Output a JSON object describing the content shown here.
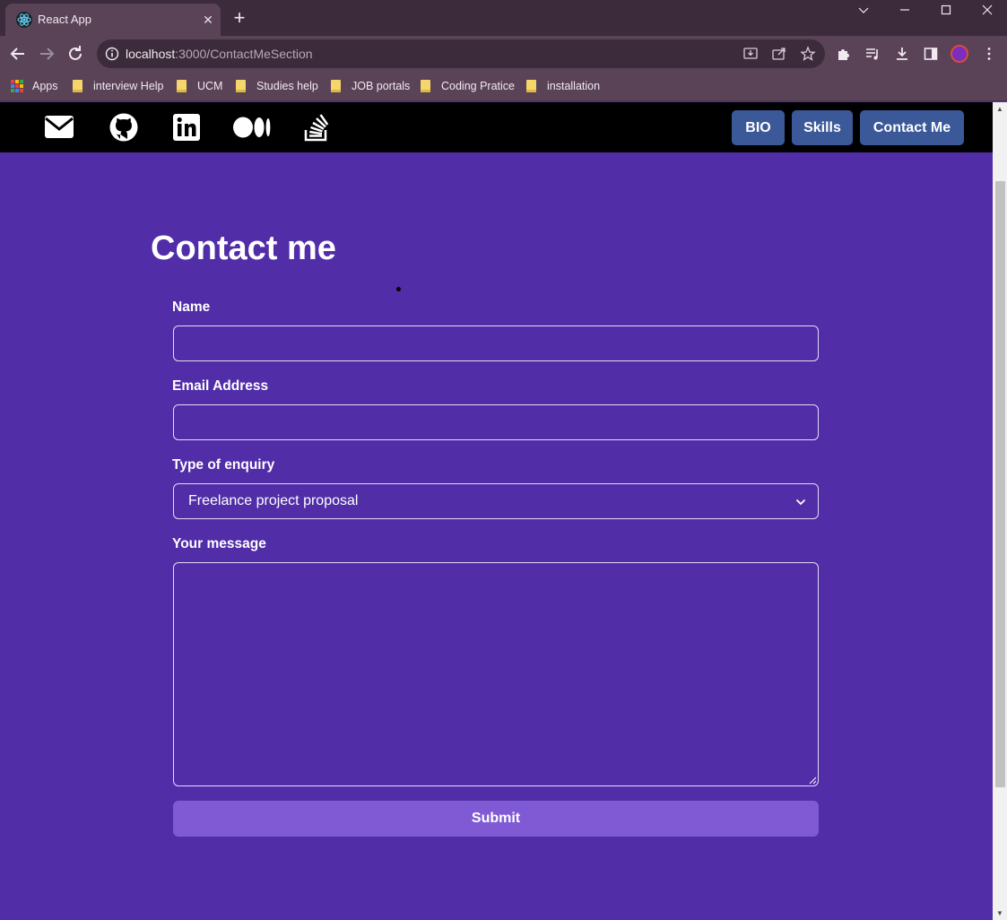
{
  "browser": {
    "tab": {
      "title": "React App",
      "close_icon": "close-icon"
    },
    "new_tab_icon": "plus-icon",
    "window_controls": [
      "chevron-down-icon",
      "minimize-icon",
      "maximize-icon",
      "close-icon"
    ],
    "address_bar": {
      "url_host": "localhost",
      "url_rest": ":3000/ContactMeSection"
    },
    "bookmarks": [
      {
        "label": "Apps",
        "icon": "apps-grid-icon"
      },
      {
        "label": "interview Help",
        "icon": "folder-icon"
      },
      {
        "label": "UCM",
        "icon": "folder-icon"
      },
      {
        "label": "Studies help",
        "icon": "folder-icon"
      },
      {
        "label": "JOB portals",
        "icon": "folder-icon"
      },
      {
        "label": "Coding Pratice",
        "icon": "folder-icon"
      },
      {
        "label": "installation",
        "icon": "folder-icon"
      }
    ]
  },
  "nav": {
    "social_icons": [
      "envelope-icon",
      "github-icon",
      "linkedin-icon",
      "medium-icon",
      "stack-overflow-icon"
    ],
    "links": [
      {
        "label": "BIO"
      },
      {
        "label": "Skills"
      },
      {
        "label": "Contact Me"
      }
    ],
    "button_color": "#3b5998"
  },
  "contact": {
    "title": "Contact me",
    "fields": {
      "name": {
        "label": "Name",
        "value": ""
      },
      "email": {
        "label": "Email Address",
        "value": ""
      },
      "enquiry": {
        "label": "Type of enquiry",
        "selected": "Freelance project proposal"
      },
      "message": {
        "label": "Your message",
        "value": ""
      }
    },
    "submit_label": "Submit"
  },
  "colors": {
    "page_background": "#512da8",
    "submit_background": "#805ad5",
    "nav_background": "#000000"
  }
}
